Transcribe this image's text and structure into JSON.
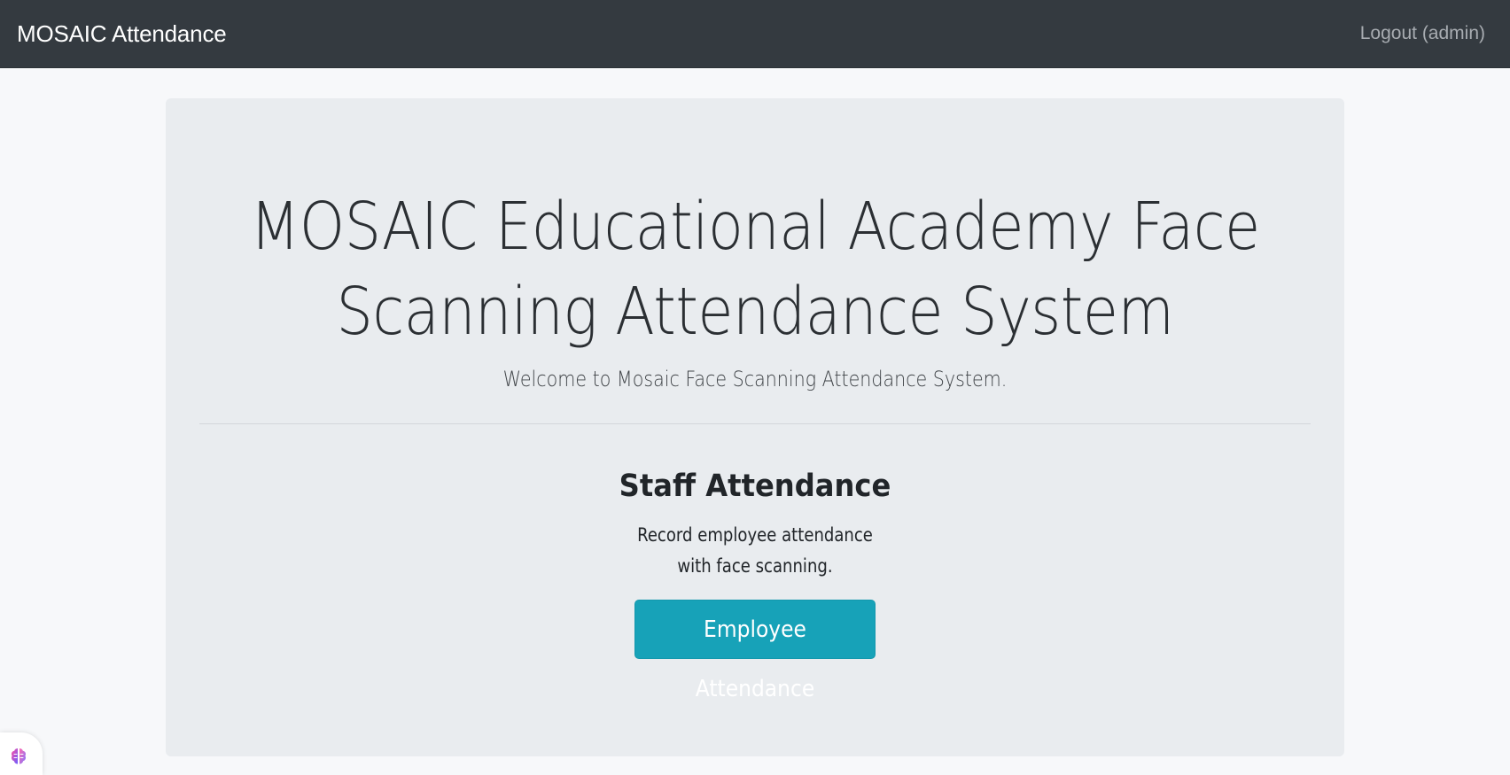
{
  "navbar": {
    "brand": "MOSAIC Attendance",
    "logout_label": "Logout (admin)"
  },
  "jumbotron": {
    "title": "MOSAIC Educational Academy Face Scanning Attendance System",
    "lead": "Welcome to Mosaic Face Scanning Attendance System."
  },
  "staff_section": {
    "title": "Staff Attendance",
    "description": "Record employee attendance with face scanning.",
    "button_label": "Employee Attendance"
  },
  "colors": {
    "navbar_bg": "#343a40",
    "jumbotron_bg": "#e9ecef",
    "button_info": "#17a2b8"
  },
  "icons": {
    "corner_widget": "brain-icon"
  }
}
